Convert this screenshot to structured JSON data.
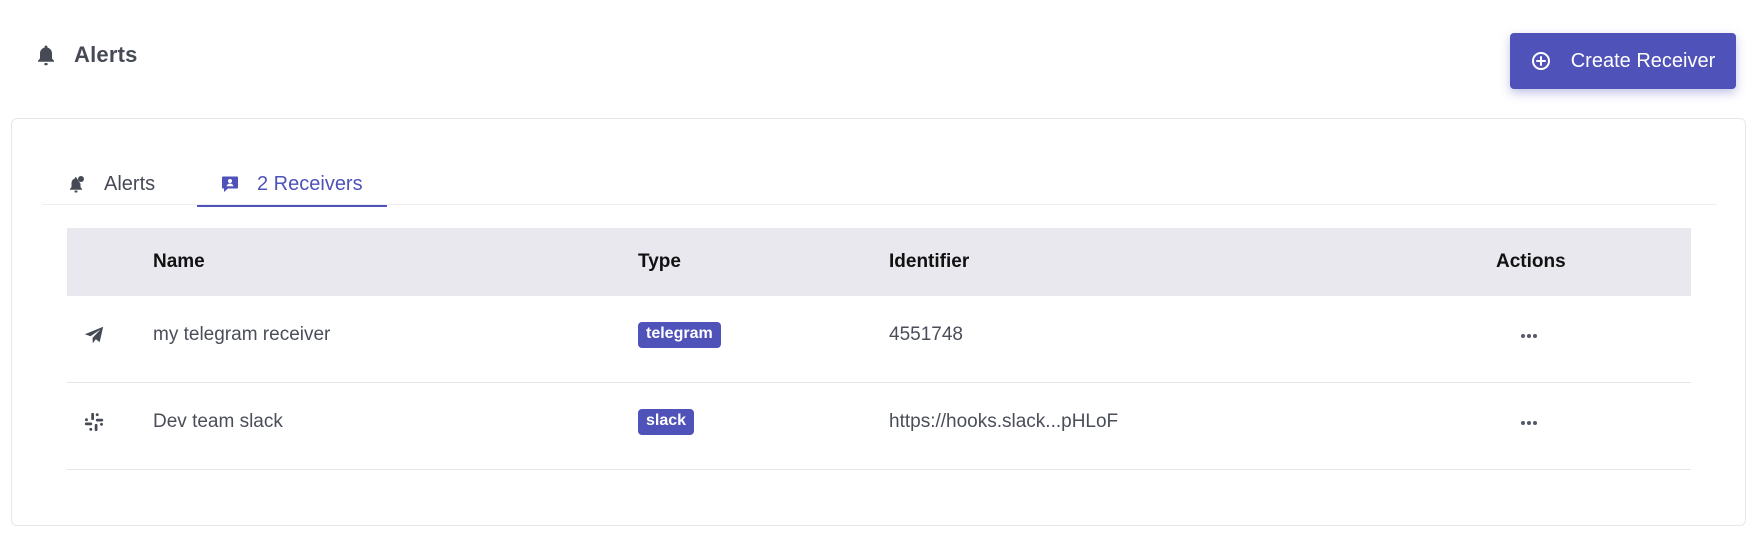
{
  "header": {
    "icon": "bell-icon",
    "title": "Alerts",
    "create_button": {
      "icon": "plus-circle-icon",
      "label": "Create Receiver"
    }
  },
  "tabs": [
    {
      "icon": "bell-badge-icon",
      "label": "Alerts",
      "active": false
    },
    {
      "icon": "receiver-chat-icon",
      "label": "2 Receivers",
      "active": true
    }
  ],
  "table": {
    "columns": [
      "",
      "Name",
      "Type",
      "Identifier",
      "Actions"
    ],
    "rows": [
      {
        "icon": "telegram-icon",
        "name": "my telegram receiver",
        "type": "telegram",
        "identifier": "4551748",
        "actions_icon": "more-horizontal-icon"
      },
      {
        "icon": "slack-icon",
        "name": "Dev team slack",
        "type": "slack",
        "identifier": "https://hooks.slack...pHLoF",
        "actions_icon": "more-horizontal-icon"
      }
    ]
  },
  "colors": {
    "accent": "#4f52b9",
    "header_bg": "#e9e8ef",
    "text": "#464a55"
  }
}
